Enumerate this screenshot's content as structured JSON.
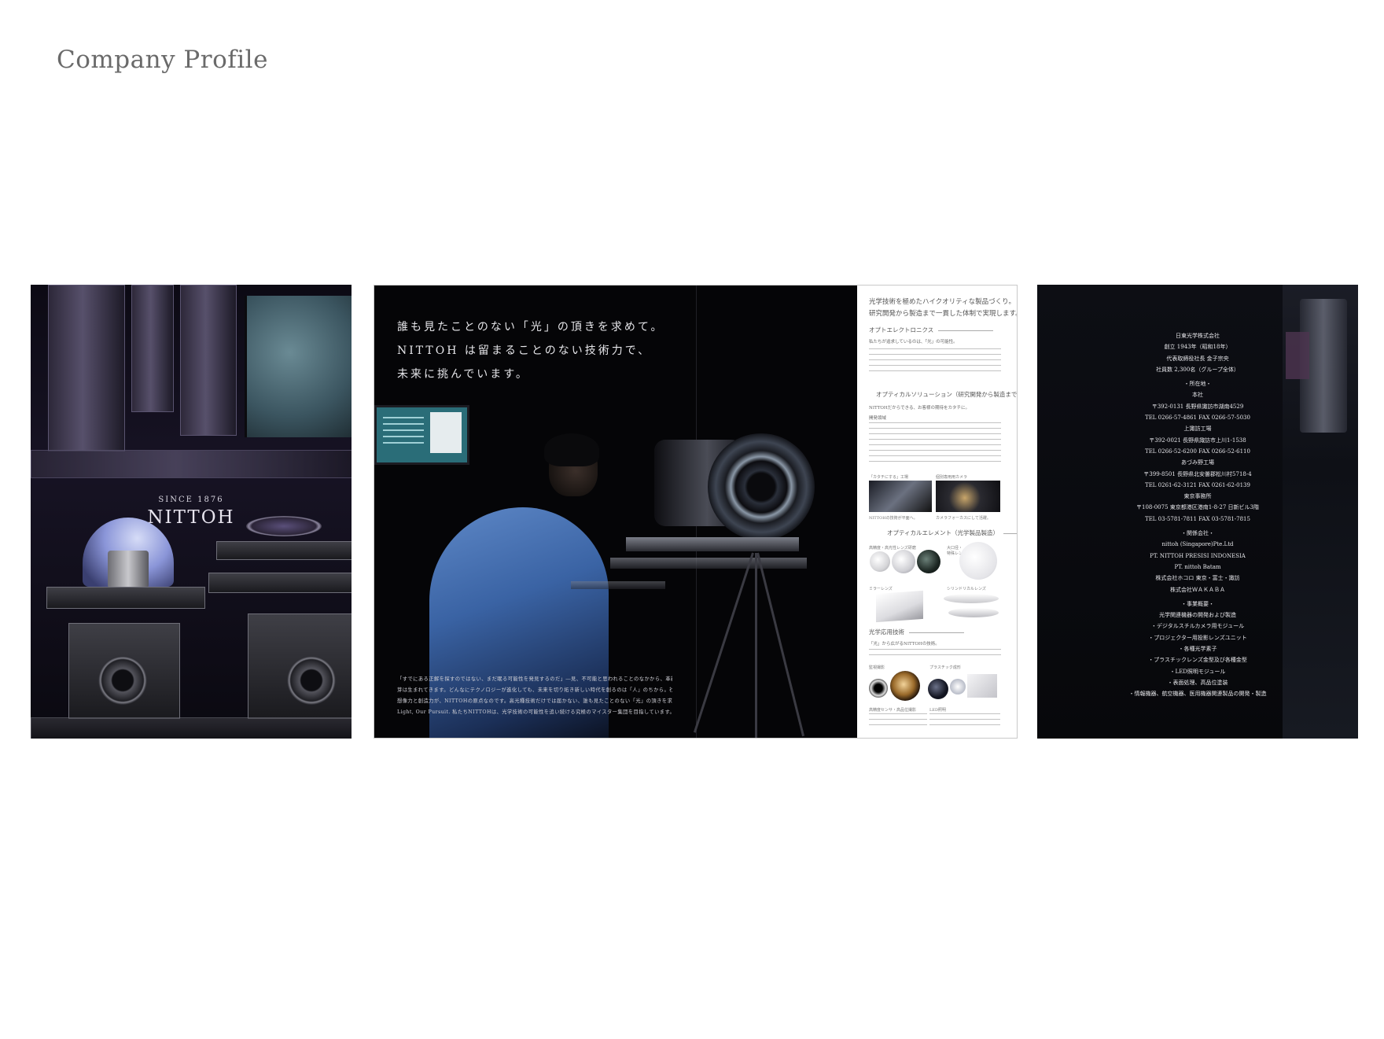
{
  "page_title": "Company Profile",
  "cover": {
    "since": "SINCE 1876",
    "brand": "NITTOH"
  },
  "spread": {
    "headline": [
      "誰も見たことのない「光」の頂きを求めて。",
      "NITTOH は留まることのない技術力で、",
      "未来に挑んでいます。"
    ],
    "body": [
      "「すでにある正解を探すのではない、まだ眠る可能性を発見するのだ」―見、不可能と思われることのなかから、革新的な技術の",
      "芽は生まれてきます。どんなにテクノロジーが進化しても、未来を切り拓き新しい時代を創るのは「人」のちから。社員一人ひとりの",
      "想像力と創造力が、NITTOHの原点なのです。高光種技術だけでは届かない、誰も見たことのない「光」の頂きを求めて。",
      "Light, Our Pursuit. 私たちNITTOHは、光学技術の可能性を追い続ける究極のマイスター集団を目指しています。"
    ],
    "info": {
      "lead": [
        "光学技術を極めたハイクオリティな製品づくり。",
        "研究開発から製造まで一貫した体制で実現します。"
      ],
      "sec_opto": "オプトエレクトロニクス",
      "opto_sub": "私たちが追求しているのは、「光」の可能性。",
      "sec_solution": "オプティカルソリューション（研究開発から製造まで）",
      "solution_sub": "NITTOHだからできる、お客様の期待をカタチに。",
      "solution_small": "開発領域",
      "photo_cap_1": "「カタチにする」工場",
      "photo_cap_2": "個別専用用カメラ",
      "photo_note_1": "NITTOHの技術が平面へ。",
      "photo_note_2": "カメラフォーカスにして活躍。",
      "sec_element": "オプティカルエレメント（光学製品製造）",
      "el_cap_1": "高精度・高光性レンズ研磨",
      "el_cap_2": "大口径・",
      "el_cap_2b": "特殊レンズ研磨",
      "el_cap_3": "ミラーレンズ",
      "el_cap_4": "シリンドリカルレンズ",
      "sec_applied": "光学応用技術",
      "applied_sub": "「光」から広がるNITTOHの技術。",
      "ap_cap_1": "監視撮影",
      "ap_cap_2": "プラスチック成形",
      "ap_note_1": "高精度センサ・高品位撮影",
      "ap_note_2": "LED照明"
    }
  },
  "back": {
    "lines": [
      "日東光学株式会社",
      "創立 1943年（昭和18年）",
      "代表取締役社長 金子宗央",
      "社員数 2,300名（グループ全体）",
      "",
      "・所在地・",
      "本社",
      "〒392-0131 長野県諏訪市湖南4529",
      "TEL 0266-57-4861 FAX 0266-57-5030",
      "上諏訪工場",
      "〒392-0021 長野県諏訪市上川1-1538",
      "TEL 0266-52-6200 FAX 0266-52-6110",
      "あづみ野工場",
      "〒399-8501 長野県北安曇郡松川村5718-4",
      "TEL 0261-62-3121 FAX 0261-62-0139",
      "東京事務所",
      "〒108-0075 東京都港区港南1-8-27 日新ビル3階",
      "TEL 03-5781-7811 FAX 03-5781-7815",
      "",
      "・関係会社・",
      "nittoh (Singapore)Pte.Ltd",
      "PT. NITTOH PRESISI INDONESIA",
      "PT. nittoh Batam",
      "株式会社ホコロ 東京・富士・諏訪",
      "株式会社ＷＡＫＡＢＡ",
      "",
      "・事業概要・",
      "光学関連機器の開発および製造",
      "・デジタルスチルカメラ用モジュール",
      "・プロジェクター用投影レンズユニット",
      "・各種光学素子",
      "・プラスチックレンズ金型及び各種金型",
      "・LED照明モジュール",
      "・表面処理、高品位塗装",
      "・情報機器、航空機器、医用機器関連製品の開発・製造"
    ]
  }
}
